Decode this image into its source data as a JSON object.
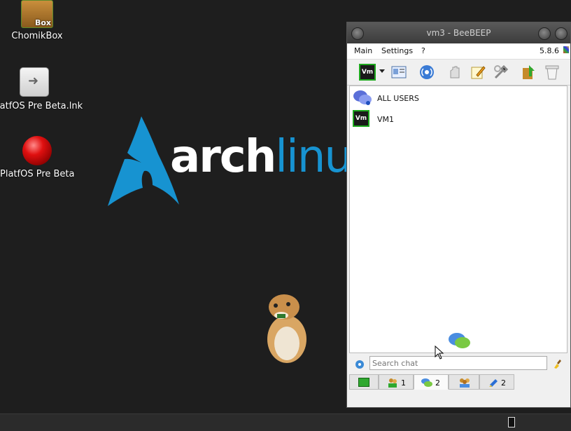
{
  "desktop": {
    "icons": [
      {
        "label": "ChomikBox",
        "badge": "Box"
      },
      {
        "label": "latfOS Pre Beta.lnk"
      },
      {
        "label": "PlatfOS Pre Beta"
      }
    ],
    "wallpaper": {
      "word1": "arch",
      "word2": "linux",
      "tm": "™"
    }
  },
  "window": {
    "title": "vm3 - BeeBEEP",
    "menu": {
      "main": "Main",
      "settings": "Settings",
      "help": "?",
      "version": "5.8.6"
    },
    "toolbar": {
      "status_avatar": "Vm"
    },
    "users": [
      {
        "name": "ALL USERS",
        "icon": "group-chat-icon"
      },
      {
        "name": "VM1",
        "avatar": "Vm"
      }
    ],
    "search": {
      "placeholder": "Search chat"
    },
    "tabs": [
      {
        "icon": "computer-icon",
        "count": ""
      },
      {
        "icon": "users-icon",
        "count": "1"
      },
      {
        "icon": "chats-icon",
        "count": "2"
      },
      {
        "icon": "groups-icon",
        "count": ""
      },
      {
        "icon": "files-icon",
        "count": "2"
      }
    ]
  },
  "colors": {
    "arch_blue": "#1793d1",
    "online_green": "#1ea81e"
  }
}
